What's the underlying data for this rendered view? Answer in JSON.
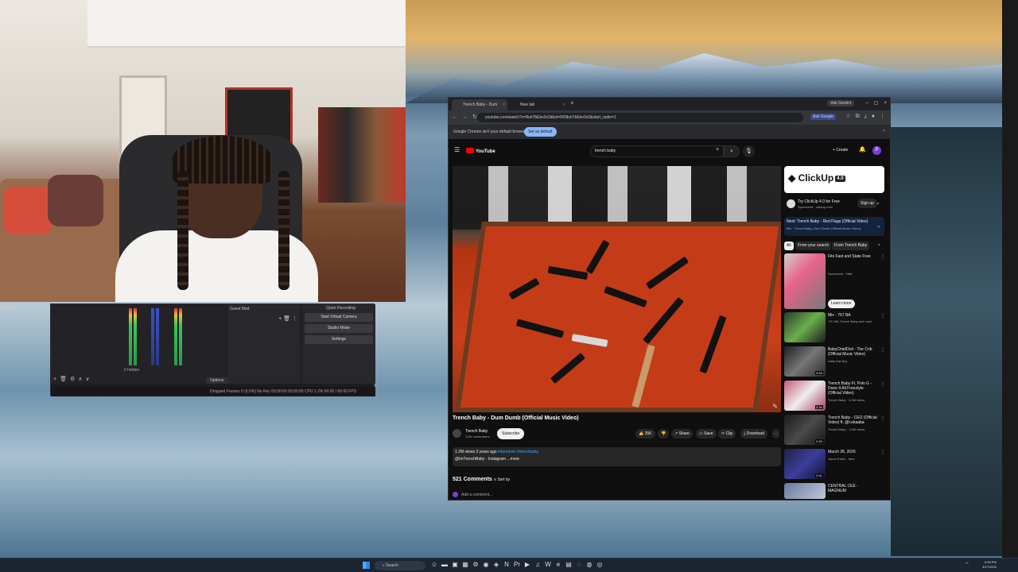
{
  "obs": {
    "sources_title": "Guest Mod",
    "meter_label": "0 hidden",
    "controls_title": "Quick Recording",
    "buttons": [
      "Start Virtual Camera",
      "Studio Mode",
      "Settings"
    ],
    "options_label": "Options",
    "status": "Dropped Frames 0 (0.0%)   No Rec   00:00:00   00:00:00   CPU 1.2%  60.00 / 60.00 FPS"
  },
  "browser": {
    "tabs": [
      {
        "title": "Trench Baby - Dum Dumb"
      },
      {
        "title": "New tab"
      }
    ],
    "ask_gemini": "Ask Gemini",
    "url": "youtube.com/watch?v=8uh7bEkn0c0&list=RD8uh7bEkn0c0&start_radio=1",
    "ask_google": "Ask Google",
    "infobar_text": "Google Chrome isn't your default browser",
    "set_default": "Set as default"
  },
  "youtube": {
    "logo": "YouTube",
    "search_value": "trench baby",
    "create_label": "Create",
    "avatar_letter": "P",
    "video_title": "Trench Baby - Dum Dumb (Official Music Video)",
    "channel_name": "Trench Baby",
    "channel_subs": "113K subscribers",
    "subscribe": "Subscribe",
    "actions": {
      "likes": "25K",
      "share": "Share",
      "save": "Save",
      "clip": "Clip",
      "download": "Download"
    },
    "desc_meta": "1.2M views  3 years ago",
    "desc_tags": "#dumdum #trenchbaby",
    "desc_line2": "@ImTrenchBaby - Instagram",
    "desc_more": "...more",
    "comments_count": "521 Comments",
    "sort_by": "Sort by",
    "add_comment": "Add a comment..."
  },
  "sidebar": {
    "ad_logo": "ClickUp",
    "ad_badge": "4.0",
    "ad_title": "Try ClickUp 4.0 for Free",
    "ad_sub": "Sponsored · clickup.com",
    "sign_up": "Sign up",
    "next_title": "Next: Trench Baby - Red Flags (Official Video)",
    "next_sub": "Mix · Trench Baby, Dum Dumb (Official Music Video)",
    "chips": [
      "All",
      "From your search",
      "From Trench Baby"
    ],
    "learn_more": "Learn more",
    "recs": [
      {
        "title": "Fits Fast and State Free",
        "meta": "Sponsored · Nike",
        "duration": ""
      },
      {
        "title": "Mix - 757 BA",
        "meta": "YG Hitt, Trench Baby and more",
        "duration": ""
      },
      {
        "title": "BabyChiefDoit - The Crib (Official Music Video)",
        "meta": "Daily Dat Boy",
        "duration": "3:53"
      },
      {
        "title": "Trench Baby Ft. Polo G - Done It All Freestyle (Official Video)",
        "meta": "Trench Baby · 3.3M views",
        "duration": "3:34"
      },
      {
        "title": "Trench Baby - CEO (Official Video) ft. @t.ekaaba",
        "meta": "Trench Baby · 1.6M views",
        "duration": "2:53"
      },
      {
        "title": "March 28, 2026",
        "meta": "Jacob Parks · New",
        "duration": "2:51"
      },
      {
        "title": "CENTRAL CEE - MAGNUM",
        "meta": "",
        "duration": ""
      }
    ]
  },
  "taskbar": {
    "search_label": "Search",
    "time": "5:38 PM",
    "date": "3/27/2026"
  }
}
